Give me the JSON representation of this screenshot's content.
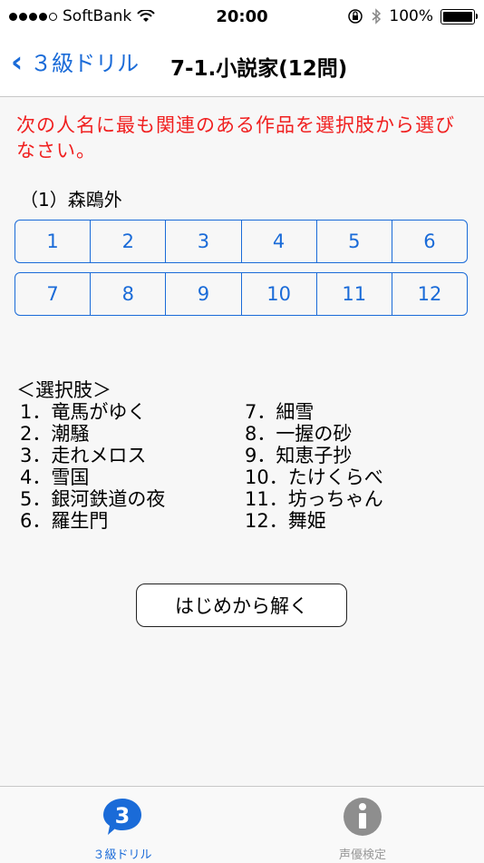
{
  "status": {
    "carrier": "SoftBank",
    "time": "20:00",
    "battery": "100%"
  },
  "nav": {
    "back_label": "３級ドリル",
    "title": "7-1.小説家(12問)"
  },
  "question": {
    "text": "次の人名に最も関連のある作品を選択肢から選びなさい。",
    "item": "（1）森鴎外"
  },
  "answers_row1": [
    "1",
    "2",
    "3",
    "4",
    "5",
    "6"
  ],
  "answers_row2": [
    "7",
    "8",
    "9",
    "10",
    "11",
    "12"
  ],
  "choices": {
    "heading": "＜選択肢＞",
    "left": [
      "1．竜馬がゆく",
      "2．潮騒",
      "3．走れメロス",
      "4．雪国",
      "5．銀河鉄道の夜",
      "6．羅生門"
    ],
    "right": [
      "7．細雪",
      "8．一握の砂",
      "9．知恵子抄",
      "10．たけくらべ",
      "11．坊っちゃん",
      "12．舞姫"
    ]
  },
  "reset_button": "はじめから解く",
  "tabs": [
    {
      "label": "３級ドリル",
      "icon": "3",
      "color": "#1a6bd8"
    },
    {
      "label": "声優検定",
      "icon": "i",
      "color": "#999999"
    }
  ]
}
